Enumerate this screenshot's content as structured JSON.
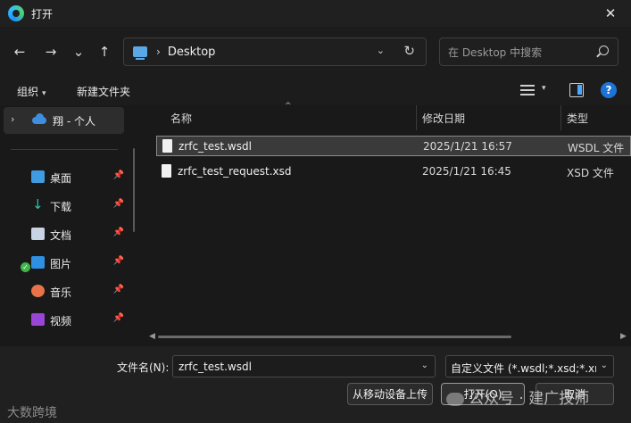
{
  "titlebar": {
    "title": "打开",
    "close_glyph": "✕"
  },
  "nav": {
    "back_glyph": "←",
    "forward_glyph": "→",
    "history_glyph": "⌄",
    "up_glyph": "↑",
    "path_sep": "›",
    "path": "Desktop",
    "dropdown_glyph": "⌄",
    "refresh_glyph": "↻"
  },
  "search": {
    "placeholder": "在 Desktop 中搜索"
  },
  "toolbar": {
    "organize": "组织",
    "new_folder": "新建文件夹",
    "caret": "▾",
    "help": "?"
  },
  "sidebar": {
    "top_item": {
      "chevron": "›",
      "label": "翔 - 个人"
    },
    "items": [
      {
        "label": "桌面",
        "icon": "desktop-icon"
      },
      {
        "label": "下载",
        "icon": "download-icon"
      },
      {
        "label": "文档",
        "icon": "documents-icon"
      },
      {
        "label": "图片",
        "icon": "pictures-icon"
      },
      {
        "label": "音乐",
        "icon": "music-icon"
      },
      {
        "label": "视频",
        "icon": "videos-icon"
      }
    ],
    "pin_glyph": "📌",
    "check_glyph": "✓"
  },
  "filelist": {
    "columns": {
      "name": "名称",
      "date": "修改日期",
      "type": "类型"
    },
    "sort_glyph": "^",
    "rows": [
      {
        "name": "zrfc_test.wsdl",
        "date": "2025/1/21 16:57",
        "type": "WSDL 文件",
        "selected": true
      },
      {
        "name": "zrfc_test_request.xsd",
        "date": "2025/1/21 16:45",
        "type": "XSD 文件",
        "selected": false
      }
    ],
    "scroll_left": "◀",
    "scroll_right": "▶"
  },
  "footer": {
    "filename_label": "文件名(N):",
    "filename_value": "zrfc_test.wsdl",
    "filetype_value": "自定义文件 (*.wsdl;*.xsd;*.xml",
    "combo_glyph": "⌄",
    "upload_button": "从移动设备上传",
    "open_button": "打开(O)",
    "cancel_button": "取消"
  },
  "watermarks": {
    "left": "大数跨境",
    "right": "公众号 · 建广技师"
  }
}
